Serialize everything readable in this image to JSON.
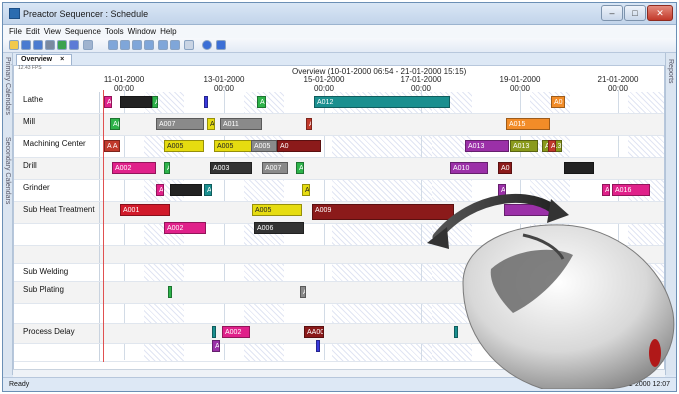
{
  "window": {
    "title": "Preactor Sequencer : Schedule"
  },
  "menu": [
    "File",
    "Edit",
    "View",
    "Sequence",
    "Tools",
    "Window",
    "Help"
  ],
  "left_tabs": [
    "Primary Calendars",
    "Secondary Calendars"
  ],
  "right_tabs": [
    "Reports"
  ],
  "doc_tab": {
    "label": "Overview",
    "close": "×"
  },
  "fps": "12.43 FPS",
  "overview": {
    "title": "Overview  (10-01-2000 06:54 - 21-01-2000 15:15)"
  },
  "time_labels": [
    "11-01-2000\n00:00",
    "13-01-2000\n00:00",
    "15-01-2000\n00:00",
    "17-01-2000\n00:00",
    "19-01-2000\n00:00",
    "21-01-2000\n00:00"
  ],
  "resources": [
    "Lathe",
    "Mill",
    "Machining Center",
    "Drill",
    "Grinder",
    "Sub Heat Treatment",
    "",
    "",
    "Sub Welding",
    "Sub Plating",
    "",
    "Process Delay",
    ""
  ],
  "bars": [
    {
      "row": 0,
      "label": "A0",
      "color": "#e0218a"
    },
    {
      "row": 0,
      "label": "",
      "color": "#222"
    },
    {
      "row": 0,
      "label": "A",
      "color": "#2db34a"
    },
    {
      "row": 0,
      "label": "",
      "color": "#3a3adc"
    },
    {
      "row": 0,
      "label": "A",
      "color": "#2db34a"
    },
    {
      "row": 0,
      "label": "A012",
      "color": "#1a8f8f"
    },
    {
      "row": 0,
      "label": "A0",
      "color": "#f28c28"
    },
    {
      "row": 1,
      "label": "A(",
      "color": "#2db34a"
    },
    {
      "row": 1,
      "label": "A007",
      "color": "#8a8a8a"
    },
    {
      "row": 1,
      "label": "A0",
      "color": "#e6dc10"
    },
    {
      "row": 1,
      "label": "A011",
      "color": "#8a8a8a"
    },
    {
      "row": 1,
      "label": "A",
      "color": "#c0392b"
    },
    {
      "row": 1,
      "label": "A015",
      "color": "#f28c28"
    },
    {
      "row": 2,
      "label": "A A",
      "color": "#c0392b"
    },
    {
      "row": 2,
      "label": "A005",
      "color": "#e6dc10"
    },
    {
      "row": 2,
      "label": "A005",
      "color": "#e6dc10"
    },
    {
      "row": 2,
      "label": "A005",
      "color": "#8a8a8a"
    },
    {
      "row": 2,
      "label": "A0",
      "color": "#8b1a1a"
    },
    {
      "row": 2,
      "label": "A013",
      "color": "#9b30a8"
    },
    {
      "row": 2,
      "label": "A013",
      "color": "#8a9a1c"
    },
    {
      "row": 2,
      "label": "A013",
      "color": "#8a9a1c"
    },
    {
      "row": 2,
      "label": "A",
      "color": "#c0392b"
    },
    {
      "row": 3,
      "label": "A002",
      "color": "#e0218a"
    },
    {
      "row": 3,
      "label": "A",
      "color": "#2db34a"
    },
    {
      "row": 3,
      "label": "A003",
      "color": "#333"
    },
    {
      "row": 3,
      "label": "A007",
      "color": "#8a8a8a"
    },
    {
      "row": 3,
      "label": "A",
      "color": "#2db34a"
    },
    {
      "row": 3,
      "label": "A010",
      "color": "#9b30a8"
    },
    {
      "row": 3,
      "label": "A0",
      "color": "#8b1a1a"
    },
    {
      "row": 3,
      "label": "",
      "color": "#222"
    },
    {
      "row": 4,
      "label": "A",
      "color": "#e0218a"
    },
    {
      "row": 4,
      "label": "",
      "color": "#222"
    },
    {
      "row": 4,
      "label": "A",
      "color": "#1a8f8f"
    },
    {
      "row": 4,
      "label": "A0",
      "color": "#e6dc10"
    },
    {
      "row": 4,
      "label": "A",
      "color": "#9b30a8"
    },
    {
      "row": 4,
      "label": "A",
      "color": "#e0218a"
    },
    {
      "row": 4,
      "label": "A016",
      "color": "#e0218a"
    },
    {
      "row": 5,
      "label": "A001",
      "color": "#d11a2a"
    },
    {
      "row": 5,
      "label": "A005",
      "color": "#e6dc10"
    },
    {
      "row": 5,
      "label": "A009",
      "color": "#8b1a1a"
    },
    {
      "row": 5,
      "label": "",
      "color": "#9b30a8"
    },
    {
      "row": 6,
      "label": "A002",
      "color": "#e0218a"
    },
    {
      "row": 6,
      "label": "A006",
      "color": "#333"
    },
    {
      "row": 9,
      "label": "",
      "color": "#2db34a"
    },
    {
      "row": 9,
      "label": "A",
      "color": "#8a8a8a"
    },
    {
      "row": 11,
      "label": "A",
      "color": "#1a8f8f"
    },
    {
      "row": 11,
      "label": "A002",
      "color": "#e0218a"
    },
    {
      "row": 11,
      "label": "AA00",
      "color": "#8b1a1a"
    },
    {
      "row": 11,
      "label": "",
      "color": "#1a8f8f"
    },
    {
      "row": 12,
      "label": "A",
      "color": "#9b30a8"
    },
    {
      "row": 12,
      "label": "",
      "color": "#3a3adc"
    }
  ],
  "status": {
    "left": "Ready",
    "right": "20-01-2000 12:07"
  }
}
